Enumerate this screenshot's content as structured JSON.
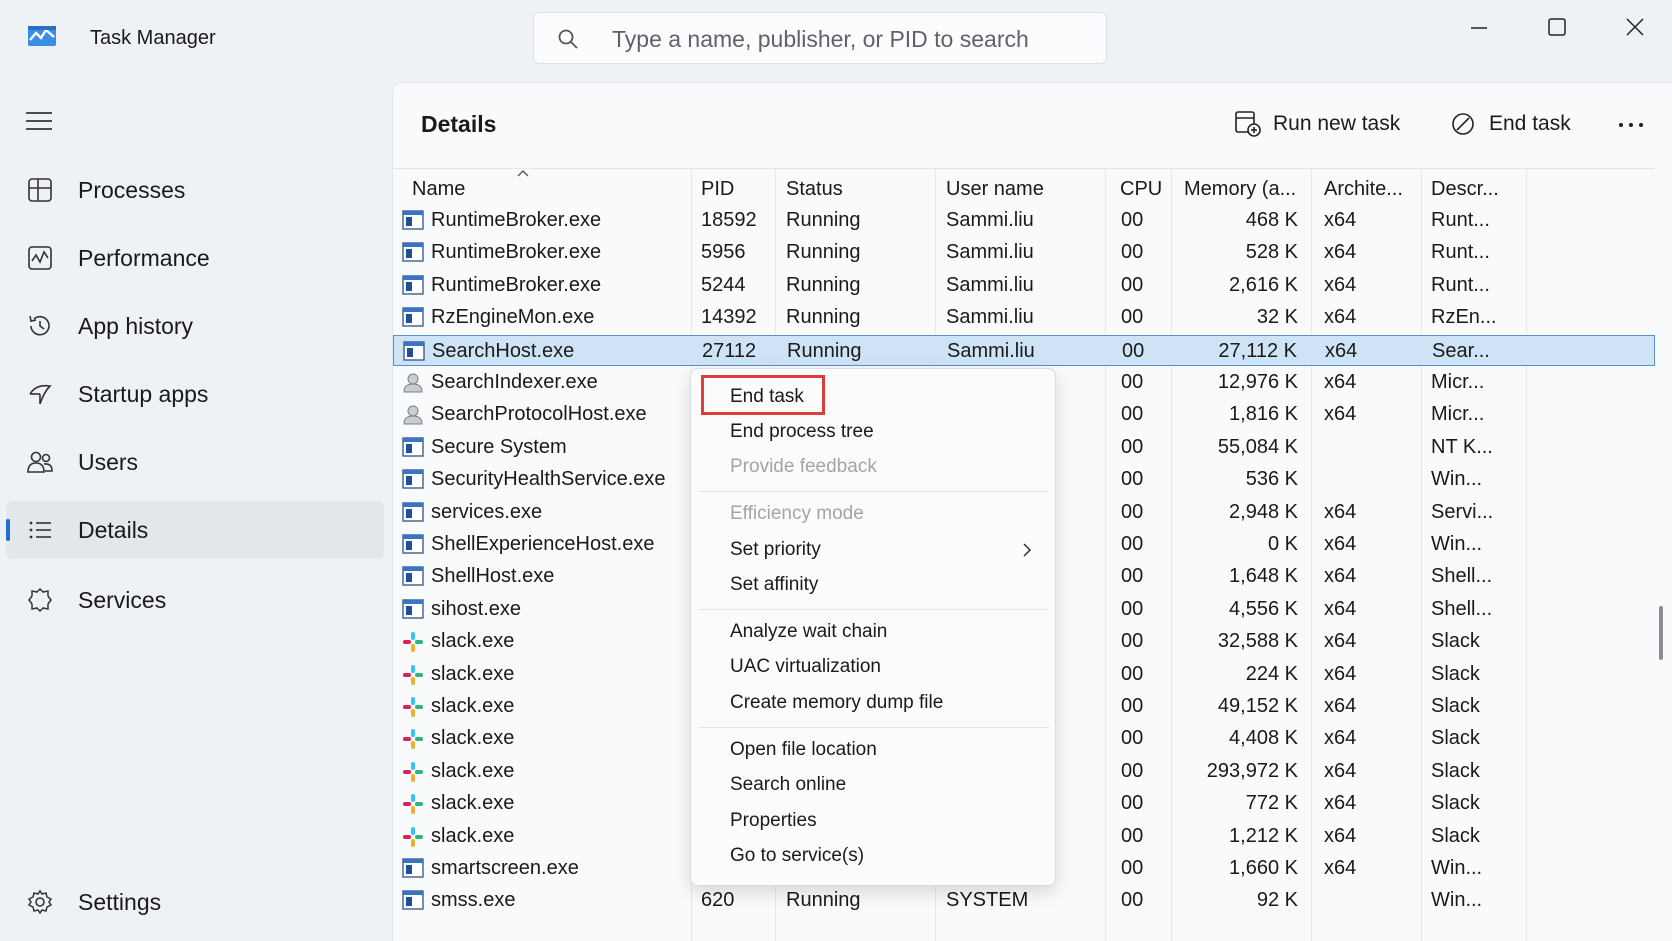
{
  "window": {
    "title": "Task Manager",
    "search_placeholder": "Type a name, publisher, or PID to search"
  },
  "sidebar": {
    "items": [
      {
        "label": "Processes",
        "icon": "processes-icon"
      },
      {
        "label": "Performance",
        "icon": "performance-icon"
      },
      {
        "label": "App history",
        "icon": "app-history-icon"
      },
      {
        "label": "Startup apps",
        "icon": "startup-apps-icon"
      },
      {
        "label": "Users",
        "icon": "users-icon"
      },
      {
        "label": "Details",
        "icon": "details-icon",
        "active": true
      },
      {
        "label": "Services",
        "icon": "services-icon"
      }
    ],
    "settings_label": "Settings"
  },
  "main": {
    "title": "Details",
    "run_new_task_label": "Run new task",
    "end_task_label": "End task"
  },
  "table": {
    "columns": [
      "Name",
      "PID",
      "Status",
      "User name",
      "CPU",
      "Memory (a...",
      "Archite...",
      "Descr..."
    ],
    "rows": [
      {
        "name": "RuntimeBroker.exe",
        "pid": "18592",
        "status": "Running",
        "user": "Sammi.liu",
        "cpu": "00",
        "mem": "468 K",
        "arch": "x64",
        "desc": "Runt...",
        "icon": "app"
      },
      {
        "name": "RuntimeBroker.exe",
        "pid": "5956",
        "status": "Running",
        "user": "Sammi.liu",
        "cpu": "00",
        "mem": "528 K",
        "arch": "x64",
        "desc": "Runt...",
        "icon": "app"
      },
      {
        "name": "RuntimeBroker.exe",
        "pid": "5244",
        "status": "Running",
        "user": "Sammi.liu",
        "cpu": "00",
        "mem": "2,616 K",
        "arch": "x64",
        "desc": "Runt...",
        "icon": "app"
      },
      {
        "name": "RzEngineMon.exe",
        "pid": "14392",
        "status": "Running",
        "user": "Sammi.liu",
        "cpu": "00",
        "mem": "32 K",
        "arch": "x64",
        "desc": "RzEn...",
        "icon": "app"
      },
      {
        "name": "SearchHost.exe",
        "pid": "27112",
        "status": "Running",
        "user": "Sammi.liu",
        "cpu": "00",
        "mem": "27,112 K",
        "arch": "x64",
        "desc": "Sear...",
        "icon": "app",
        "selected": true
      },
      {
        "name": "SearchIndexer.exe",
        "pid": "",
        "status": "",
        "user": "",
        "cpu": "00",
        "mem": "12,976 K",
        "arch": "x64",
        "desc": "Micr...",
        "icon": "user"
      },
      {
        "name": "SearchProtocolHost.exe",
        "pid": "",
        "status": "",
        "user": "",
        "cpu": "00",
        "mem": "1,816 K",
        "arch": "x64",
        "desc": "Micr...",
        "icon": "user"
      },
      {
        "name": "Secure System",
        "pid": "",
        "status": "",
        "user": "",
        "cpu": "00",
        "mem": "55,084 K",
        "arch": "",
        "desc": "NT K...",
        "icon": "app"
      },
      {
        "name": "SecurityHealthService.exe",
        "pid": "",
        "status": "",
        "user": "",
        "cpu": "00",
        "mem": "536 K",
        "arch": "",
        "desc": "Win...",
        "icon": "app"
      },
      {
        "name": "services.exe",
        "pid": "",
        "status": "",
        "user": "",
        "cpu": "00",
        "mem": "2,948 K",
        "arch": "x64",
        "desc": "Servi...",
        "icon": "app"
      },
      {
        "name": "ShellExperienceHost.exe",
        "pid": "",
        "status": "",
        "user": "",
        "cpu": "00",
        "mem": "0 K",
        "arch": "x64",
        "desc": "Win...",
        "icon": "app"
      },
      {
        "name": "ShellHost.exe",
        "pid": "",
        "status": "",
        "user": "",
        "cpu": "00",
        "mem": "1,648 K",
        "arch": "x64",
        "desc": "Shell...",
        "icon": "app"
      },
      {
        "name": "sihost.exe",
        "pid": "",
        "status": "",
        "user": "",
        "cpu": "00",
        "mem": "4,556 K",
        "arch": "x64",
        "desc": "Shell...",
        "icon": "app"
      },
      {
        "name": "slack.exe",
        "pid": "",
        "status": "",
        "user": "",
        "cpu": "00",
        "mem": "32,588 K",
        "arch": "x64",
        "desc": "Slack",
        "icon": "slack"
      },
      {
        "name": "slack.exe",
        "pid": "",
        "status": "",
        "user": "",
        "cpu": "00",
        "mem": "224 K",
        "arch": "x64",
        "desc": "Slack",
        "icon": "slack"
      },
      {
        "name": "slack.exe",
        "pid": "",
        "status": "",
        "user": "",
        "cpu": "00",
        "mem": "49,152 K",
        "arch": "x64",
        "desc": "Slack",
        "icon": "slack"
      },
      {
        "name": "slack.exe",
        "pid": "",
        "status": "",
        "user": "",
        "cpu": "00",
        "mem": "4,408 K",
        "arch": "x64",
        "desc": "Slack",
        "icon": "slack"
      },
      {
        "name": "slack.exe",
        "pid": "",
        "status": "",
        "user": "",
        "cpu": "00",
        "mem": "293,972 K",
        "arch": "x64",
        "desc": "Slack",
        "icon": "slack"
      },
      {
        "name": "slack.exe",
        "pid": "",
        "status": "",
        "user": "",
        "cpu": "00",
        "mem": "772 K",
        "arch": "x64",
        "desc": "Slack",
        "icon": "slack"
      },
      {
        "name": "slack.exe",
        "pid": "",
        "status": "",
        "user": "",
        "cpu": "00",
        "mem": "1,212 K",
        "arch": "x64",
        "desc": "Slack",
        "icon": "slack"
      },
      {
        "name": "smartscreen.exe",
        "pid": "",
        "status": "",
        "user": "",
        "cpu": "00",
        "mem": "1,660 K",
        "arch": "x64",
        "desc": "Win...",
        "icon": "app"
      },
      {
        "name": "smss.exe",
        "pid": "620",
        "status": "Running",
        "user": "SYSTEM",
        "cpu": "00",
        "mem": "92 K",
        "arch": "",
        "desc": "Win...",
        "icon": "app"
      }
    ]
  },
  "context_menu": {
    "groups": [
      [
        {
          "label": "End task",
          "enabled": true,
          "highlighted": true
        },
        {
          "label": "End process tree",
          "enabled": true
        },
        {
          "label": "Provide feedback",
          "enabled": false
        }
      ],
      [
        {
          "label": "Efficiency mode",
          "enabled": false
        },
        {
          "label": "Set priority",
          "enabled": true,
          "submenu": true
        },
        {
          "label": "Set affinity",
          "enabled": true
        }
      ],
      [
        {
          "label": "Analyze wait chain",
          "enabled": true
        },
        {
          "label": "UAC virtualization",
          "enabled": true
        },
        {
          "label": "Create memory dump file",
          "enabled": true
        }
      ],
      [
        {
          "label": "Open file location",
          "enabled": true
        },
        {
          "label": "Search online",
          "enabled": true
        },
        {
          "label": "Properties",
          "enabled": true
        },
        {
          "label": "Go to service(s)",
          "enabled": true
        }
      ]
    ]
  },
  "colors": {
    "accent": "#1f6fd1",
    "selection": "#cfe3f7",
    "highlight_border": "#e03b3b"
  }
}
